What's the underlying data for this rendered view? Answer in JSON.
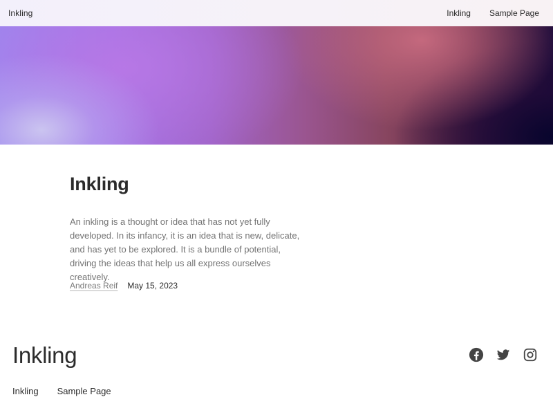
{
  "header": {
    "site_title": "Inkling",
    "nav": [
      {
        "label": "Inkling"
      },
      {
        "label": "Sample Page"
      }
    ]
  },
  "hero": {
    "colors": [
      "#9b86ee",
      "#a274e6",
      "#a064c8",
      "#87455f",
      "#1d0b3a"
    ]
  },
  "post": {
    "title": "Inkling",
    "excerpt": "An inkling is a thought or idea that has not yet fully developed. In its infancy, it is an idea that is new, delicate, and has yet to be explored. It is a bundle of potential, driving the ideas that help us all express ourselves creatively.",
    "author": "Andreas Reif",
    "date": "May 15, 2023"
  },
  "footer": {
    "site_title": "Inkling",
    "social_icons": [
      "facebook-icon",
      "twitter-icon",
      "instagram-icon"
    ],
    "nav": [
      {
        "label": "Inkling"
      },
      {
        "label": "Sample Page"
      }
    ]
  }
}
